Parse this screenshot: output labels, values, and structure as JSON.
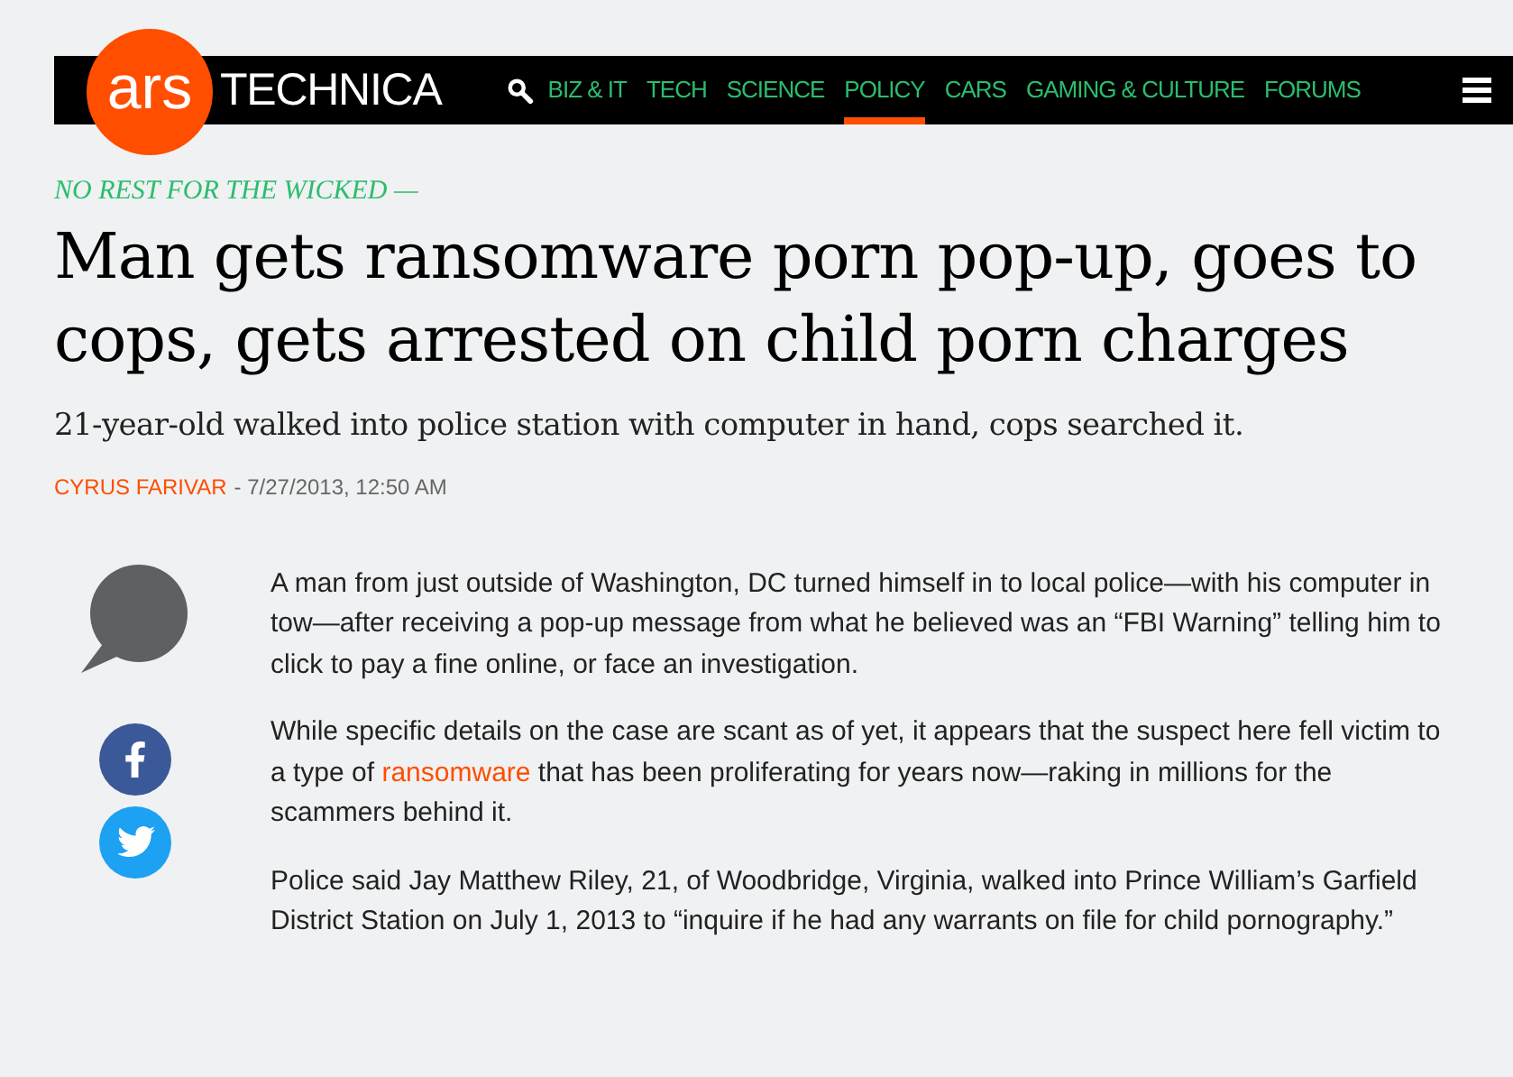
{
  "header": {
    "logo_mark": "ars",
    "logo_text": "TECHNICA",
    "nav": [
      {
        "label": "BIZ & IT",
        "selected": false
      },
      {
        "label": "TECH",
        "selected": false
      },
      {
        "label": "SCIENCE",
        "selected": false
      },
      {
        "label": "POLICY",
        "selected": true
      },
      {
        "label": "CARS",
        "selected": false
      },
      {
        "label": "GAMING & CULTURE",
        "selected": false
      },
      {
        "label": "FORUMS",
        "selected": false
      }
    ]
  },
  "article": {
    "kicker": "NO REST FOR THE WICKED —",
    "title": "Man gets ransomware porn pop-up, goes to cops, gets arrested on child porn charges",
    "subtitle": "21-year-old walked into police station with computer in hand, cops searched it.",
    "author": "CYRUS FARIVAR",
    "dateline": "- 7/27/2013, 12:50 AM",
    "paragraphs": [
      [
        {
          "kind": "text",
          "text": "A man from just outside of Washington, DC turned himself in to local police—with his computer in tow—after receiving a pop-up message from what he believed was an “FBI Warning” telling him to click to pay a fine online, or face an investigation."
        }
      ],
      [
        {
          "kind": "text",
          "text": "While specific details on the case are scant as of yet, it appears that the suspect here fell victim to a type of "
        },
        {
          "kind": "link",
          "text": "ransomware"
        },
        {
          "kind": "text",
          "text": " that has been proliferating for years now—raking in millions for the scammers behind it."
        }
      ],
      [
        {
          "kind": "text",
          "text": "Police said Jay Matthew Riley, 21, of Woodbridge, Virginia, walked into Prince William’s Garfield District Station on July 1, 2013 to “inquire if he had any warrants on file for child pornography.”"
        }
      ]
    ]
  }
}
